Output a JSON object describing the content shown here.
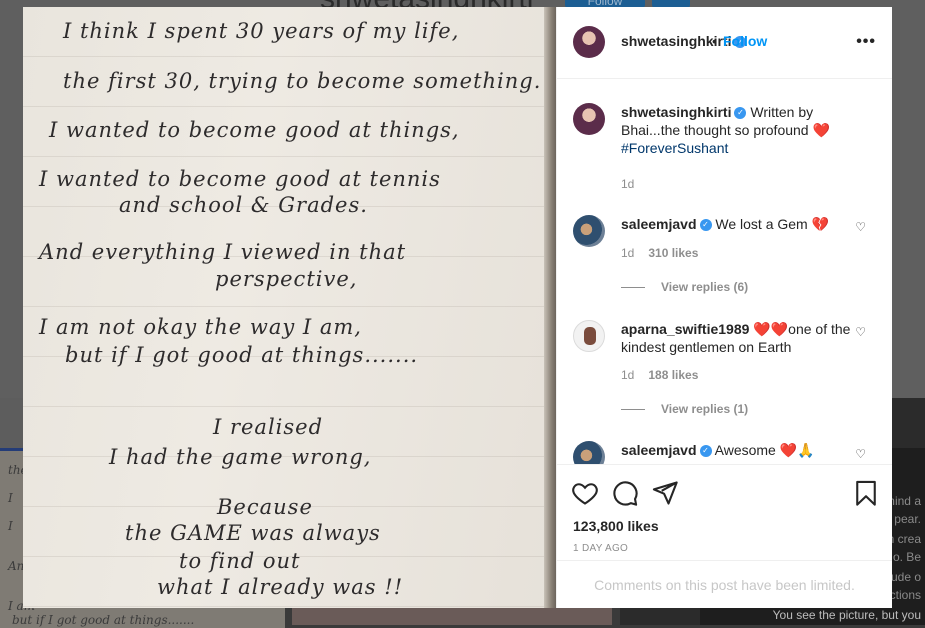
{
  "background": {
    "profile_name": "shwetasinghkirti",
    "follow_label": "Follow",
    "left_thumb_lines": [
      "the",
      "I",
      "I",
      "And",
      "I am",
      "but if I got good at things......."
    ],
    "right_thumb_lines": [
      "hind a",
      "pear.",
      "n crea",
      "o. Be",
      "itude o",
      "ctions",
      "You see the picture, but you"
    ]
  },
  "post": {
    "handwritten_note": [
      "I think I spent 30 years of my life,",
      "the first 30, trying to become something.",
      "I wanted to become good at things,",
      "I wanted to become good at tennis",
      "and school & Grades.",
      "And everything I viewed in that",
      "perspective,",
      "I am not okay the way I am,",
      "but if I got good at things.......",
      "I realised",
      "I had the game wrong,",
      "Because",
      "the GAME was always",
      "to find out",
      "what I already was !!"
    ]
  },
  "header": {
    "username": "shwetasinghkirti",
    "dot": "•",
    "follow_label": "Follow",
    "more_icon": "more-horizontal-icon"
  },
  "caption": {
    "username": "shwetasinghkirti",
    "text": "Written by Bhai...the thought so profound ❤️",
    "hashtag": "#ForeverSushant",
    "time": "1d"
  },
  "comments": [
    {
      "username": "saleemjavd",
      "verified": true,
      "text": "We lost a Gem 💔",
      "time": "1d",
      "likes": "310 likes",
      "replies": "View replies (6)"
    },
    {
      "username": "aparna_swiftie1989",
      "verified": false,
      "text": "❤️❤️one of the kindest gentlemen on Earth",
      "time": "1d",
      "likes": "188 likes",
      "replies": "View replies (1)"
    },
    {
      "username": "saleemjavd",
      "verified": true,
      "text": "Awesome ❤️🙏"
    }
  ],
  "actions": {
    "like_icon": "heart-icon",
    "comment_icon": "comment-icon",
    "share_icon": "share-icon",
    "save_icon": "bookmark-icon",
    "likes": "123,800 likes",
    "time_ago": "1 DAY AGO",
    "limited_notice": "Comments on this post have been limited."
  },
  "colors": {
    "accent": "#0095f6",
    "verified": "#3897f0",
    "heart_red": "#ed4956",
    "text": "#262626",
    "muted": "#8e8e8e"
  }
}
